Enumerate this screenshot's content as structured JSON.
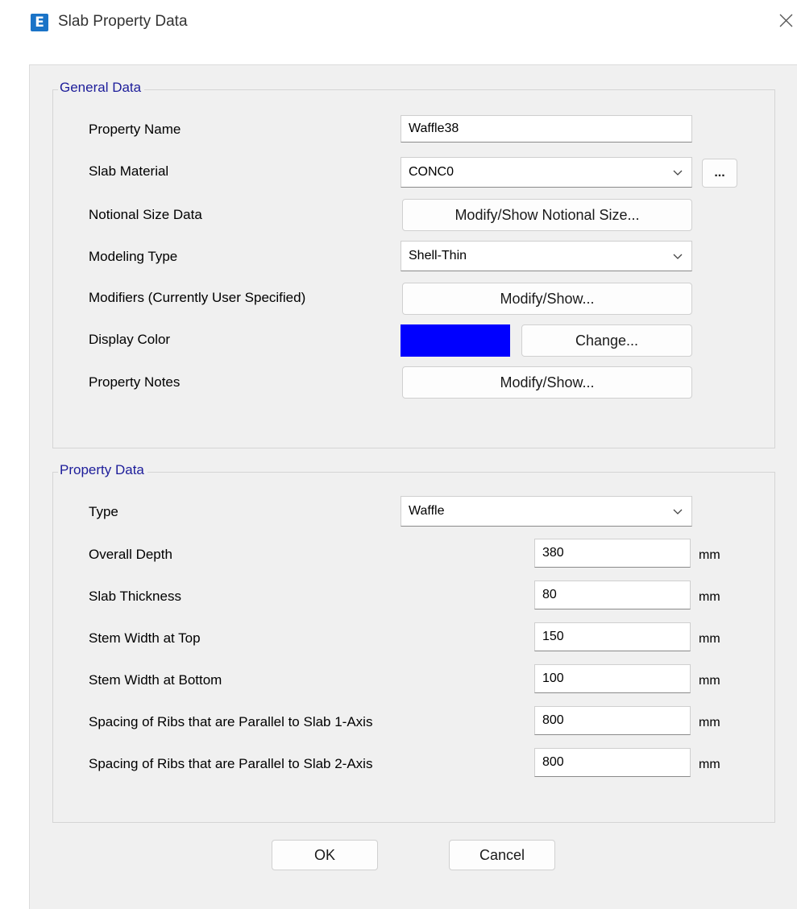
{
  "window": {
    "app_icon_letter": "E",
    "title": "Slab Property Data"
  },
  "general": {
    "group_title": "General Data",
    "property_name": {
      "label": "Property Name",
      "value": "Waffle38"
    },
    "slab_material": {
      "label": "Slab Material",
      "value": "CONC0",
      "more_label": "..."
    },
    "notional_size": {
      "label": "Notional Size Data",
      "button": "Modify/Show Notional Size..."
    },
    "modeling_type": {
      "label": "Modeling Type",
      "value": "Shell-Thin"
    },
    "modifiers": {
      "label": "Modifiers (Currently User Specified)",
      "button": "Modify/Show..."
    },
    "display_color": {
      "label": "Display Color",
      "color": "#0000ff",
      "button": "Change..."
    },
    "property_notes": {
      "label": "Property Notes",
      "button": "Modify/Show..."
    }
  },
  "property": {
    "group_title": "Property Data",
    "type": {
      "label": "Type",
      "value": "Waffle"
    },
    "rows": [
      {
        "label": "Overall Depth",
        "value": "380",
        "unit": "mm"
      },
      {
        "label": "Slab Thickness",
        "value": "80",
        "unit": "mm"
      },
      {
        "label": "Stem Width at Top",
        "value": "150",
        "unit": "mm"
      },
      {
        "label": "Stem Width at Bottom",
        "value": "100",
        "unit": "mm"
      },
      {
        "label": "Spacing of Ribs that are Parallel to Slab 1-Axis",
        "value": "800",
        "unit": "mm"
      },
      {
        "label": "Spacing of Ribs that are Parallel to Slab 2-Axis",
        "value": "800",
        "unit": "mm"
      }
    ]
  },
  "footer": {
    "ok": "OK",
    "cancel": "Cancel"
  }
}
